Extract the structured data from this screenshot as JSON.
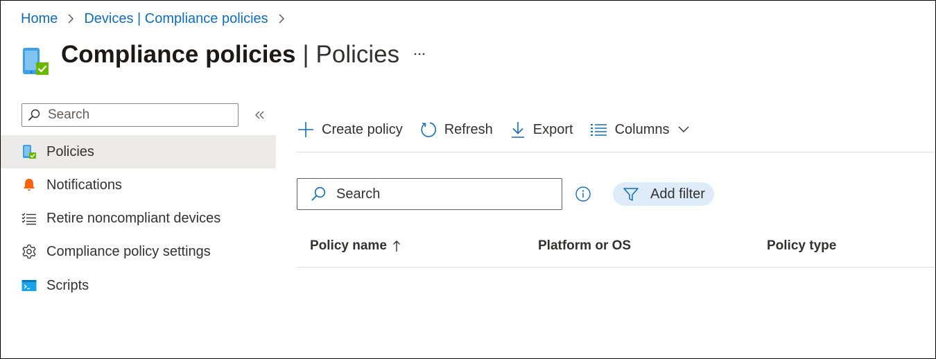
{
  "breadcrumb": {
    "items": [
      "Home",
      "Devices | Compliance policies"
    ]
  },
  "header": {
    "title_bold": "Compliance policies",
    "title_separator": "|",
    "title_light": "Policies",
    "more_icon": "more-horizontal-icon"
  },
  "nav": {
    "search_placeholder": "Search",
    "items": [
      {
        "label": "Policies",
        "icon": "compliance-device-icon",
        "active": true
      },
      {
        "label": "Notifications",
        "icon": "bell-icon",
        "active": false
      },
      {
        "label": "Retire noncompliant devices",
        "icon": "checklist-icon",
        "active": false
      },
      {
        "label": "Compliance policy settings",
        "icon": "gear-icon",
        "active": false
      },
      {
        "label": "Scripts",
        "icon": "terminal-icon",
        "active": false
      }
    ]
  },
  "toolbar": {
    "create_label": "Create policy",
    "refresh_label": "Refresh",
    "export_label": "Export",
    "columns_label": "Columns"
  },
  "main": {
    "search_placeholder": "Search",
    "add_filter_label": "Add filter"
  },
  "table": {
    "columns": [
      "Policy name",
      "Platform or OS",
      "Policy type"
    ],
    "sort_column": "Policy name",
    "sort_direction": "ascending",
    "rows": []
  },
  "colors": {
    "accent": "#0f6cbd",
    "active_nav": "#edebe9",
    "filter_pill": "#deecf9",
    "check_green": "#6bb700",
    "bell_orange": "#f7630c"
  }
}
